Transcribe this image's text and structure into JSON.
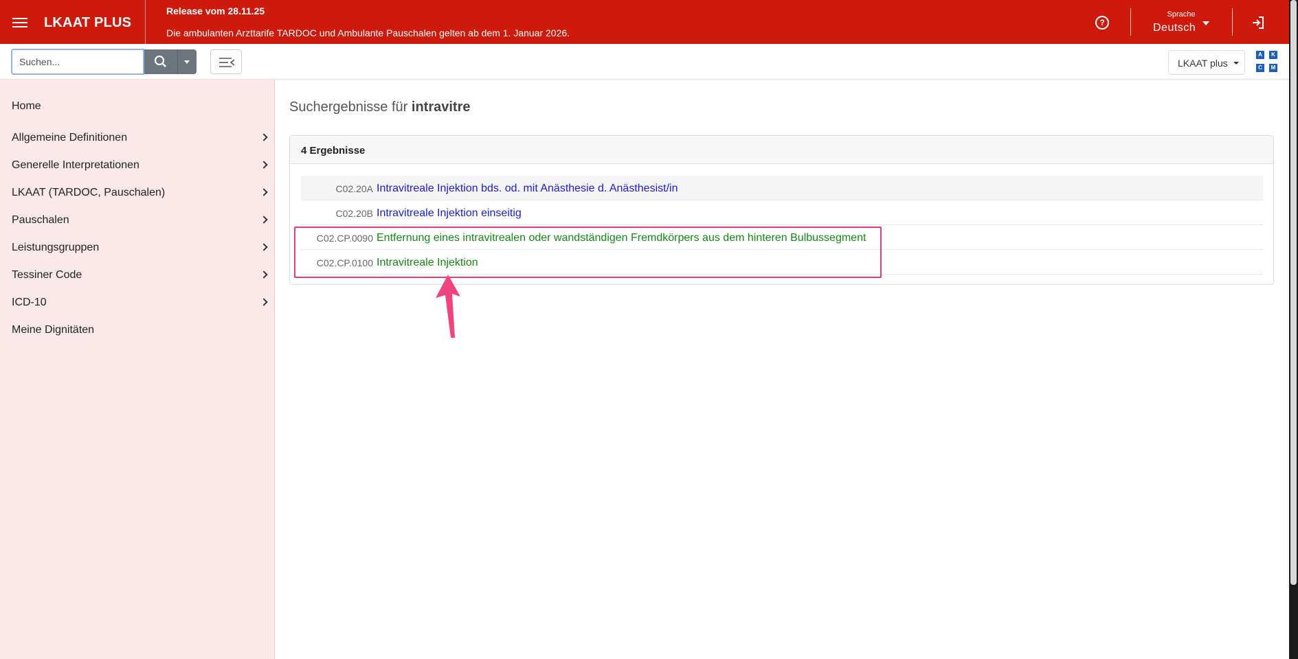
{
  "header": {
    "brand": "LKAAT PLUS",
    "release_title": "Release vom 28.11.25",
    "release_text": "Die ambulanten Arzttarife TARDOC und Ambulante Pauschalen gelten ab dem 1. Januar 2026.",
    "language_label": "Sprache",
    "language_value": "Deutsch",
    "help_glyph": "?"
  },
  "toolbar": {
    "search_placeholder": "Suchen...",
    "search_value": "",
    "catalog_dropdown": "LKAAT plus",
    "akcm": [
      "A",
      "K",
      "C",
      "M"
    ]
  },
  "sidebar": {
    "items": [
      {
        "label": "Home",
        "has_children": false
      },
      {
        "label": "Allgemeine Definitionen",
        "has_children": true
      },
      {
        "label": "Generelle Interpretationen",
        "has_children": true
      },
      {
        "label": "LKAAT (TARDOC, Pauschalen)",
        "has_children": true
      },
      {
        "label": "Pauschalen",
        "has_children": true
      },
      {
        "label": "Leistungsgruppen",
        "has_children": true
      },
      {
        "label": "Tessiner Code",
        "has_children": true
      },
      {
        "label": "ICD-10",
        "has_children": true
      },
      {
        "label": "Meine Dignitäten",
        "has_children": false
      }
    ]
  },
  "main": {
    "title_prefix": "Suchergebnisse für",
    "query": "intravitre",
    "results_count_label": "4 Ergebnisse",
    "results": [
      {
        "code": "C02.20A",
        "title": "Intravitreale Injektion bds. od. mit Anästhesie d. Anästhesist/in",
        "color": "#1a1ad6"
      },
      {
        "code": "C02.20B",
        "title": "Intravitreale Injektion einseitig",
        "color": "#1a1ad6"
      },
      {
        "code": "C02.CP.0090",
        "title": "Entfernung eines intravitrealen oder wandständigen Fremdkörpers aus dem hinteren Bulbussegment",
        "color": "#128a12"
      },
      {
        "code": "C02.CP.0100",
        "title": "Intravitreale Injektion",
        "color": "#128a12"
      }
    ]
  },
  "colors": {
    "header_red": "#cd1a0c",
    "sidebar_bg": "#fbe9ea",
    "annotation_pink": "#e83a7a"
  }
}
